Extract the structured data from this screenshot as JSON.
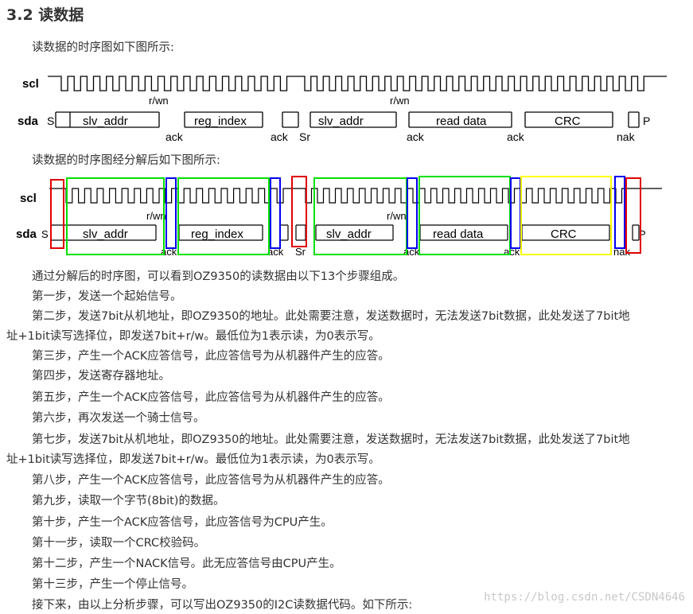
{
  "heading": "3.2 读数据",
  "intro1": "读数据的时序图如下图所示:",
  "intro2": "读数据的时序图经分解后如下图所示:",
  "diagram": {
    "scl": "scl",
    "sda": "sda",
    "s": "S",
    "sr": "Sr",
    "p": "P",
    "rwn": "r/wn",
    "ack": "ack",
    "nak": "nak",
    "slv_addr": "slv_addr",
    "reg_index": "reg_index",
    "read_data": "read data",
    "crc": "CRC"
  },
  "para": [
    "通过分解后的时序图，可以看到OZ9350的读数据由以下13个步骤组成。",
    "第一步，发送一个起始信号。",
    "第二步，发送7bit从机地址，即OZ9350的地址。此处需要注意，发送数据时，无法发送7bit数据，此处发送了7bit地",
    "址+1bit读写选择位，即发送7bit+r/w。最低位为1表示读，为0表示写。",
    "第三步，产生一个ACK应答信号，此应答信号为从机器件产生的应答。",
    "第四步，发送寄存器地址。",
    "第五步，产生一个ACK应答信号，此应答信号为从机器件产生的应答。",
    "第六步，再次发送一个骑士信号。",
    "第七步，发送7bit从机地址，即OZ9350的地址。此处需要注意，发送数据时，无法发送7bit数据，此处发送了7bit地",
    "址+1bit读写选择位，即发送7bit+r/w。最低位为1表示读，为0表示写。",
    "第八步，产生一个ACK应答信号，此应答信号为从机器件产生的应答。",
    "第九步，读取一个字节(8bit)的数据。",
    "第十步，产生一个ACK应答信号，此应答信号为CPU产生。",
    "第十一步，读取一个CRC校验码。",
    "第十二步，产生一个NACK信号。此无应答信号由CPU产生。",
    "第十三步，产生一个停止信号。",
    "接下来，由以上分析步骤，可以写出OZ9350的I2C读数据代码。如下所示:"
  ],
  "watermark": "https://blog.csdn.net/CSDN4646",
  "colors": {
    "red": "#e00000",
    "green": "#00e000",
    "blue": "#0000ee",
    "yellow": "#ffff00"
  }
}
